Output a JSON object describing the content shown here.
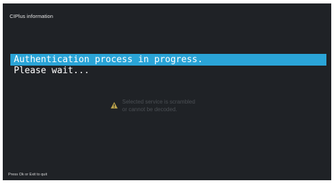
{
  "header": {
    "title": "CIPlus information"
  },
  "message": {
    "line1": "Authentication process in progress.",
    "line2": "Please wait..."
  },
  "notice": {
    "icon": "warning-icon",
    "icon_color": "#b8a04a",
    "line1": "Selected service is scrambled",
    "line2": "or cannot be decoded."
  },
  "footer": {
    "hint": "Press Ok or Exit to quit"
  },
  "colors": {
    "background": "#1f2226",
    "highlight": "#2aa4d7"
  }
}
